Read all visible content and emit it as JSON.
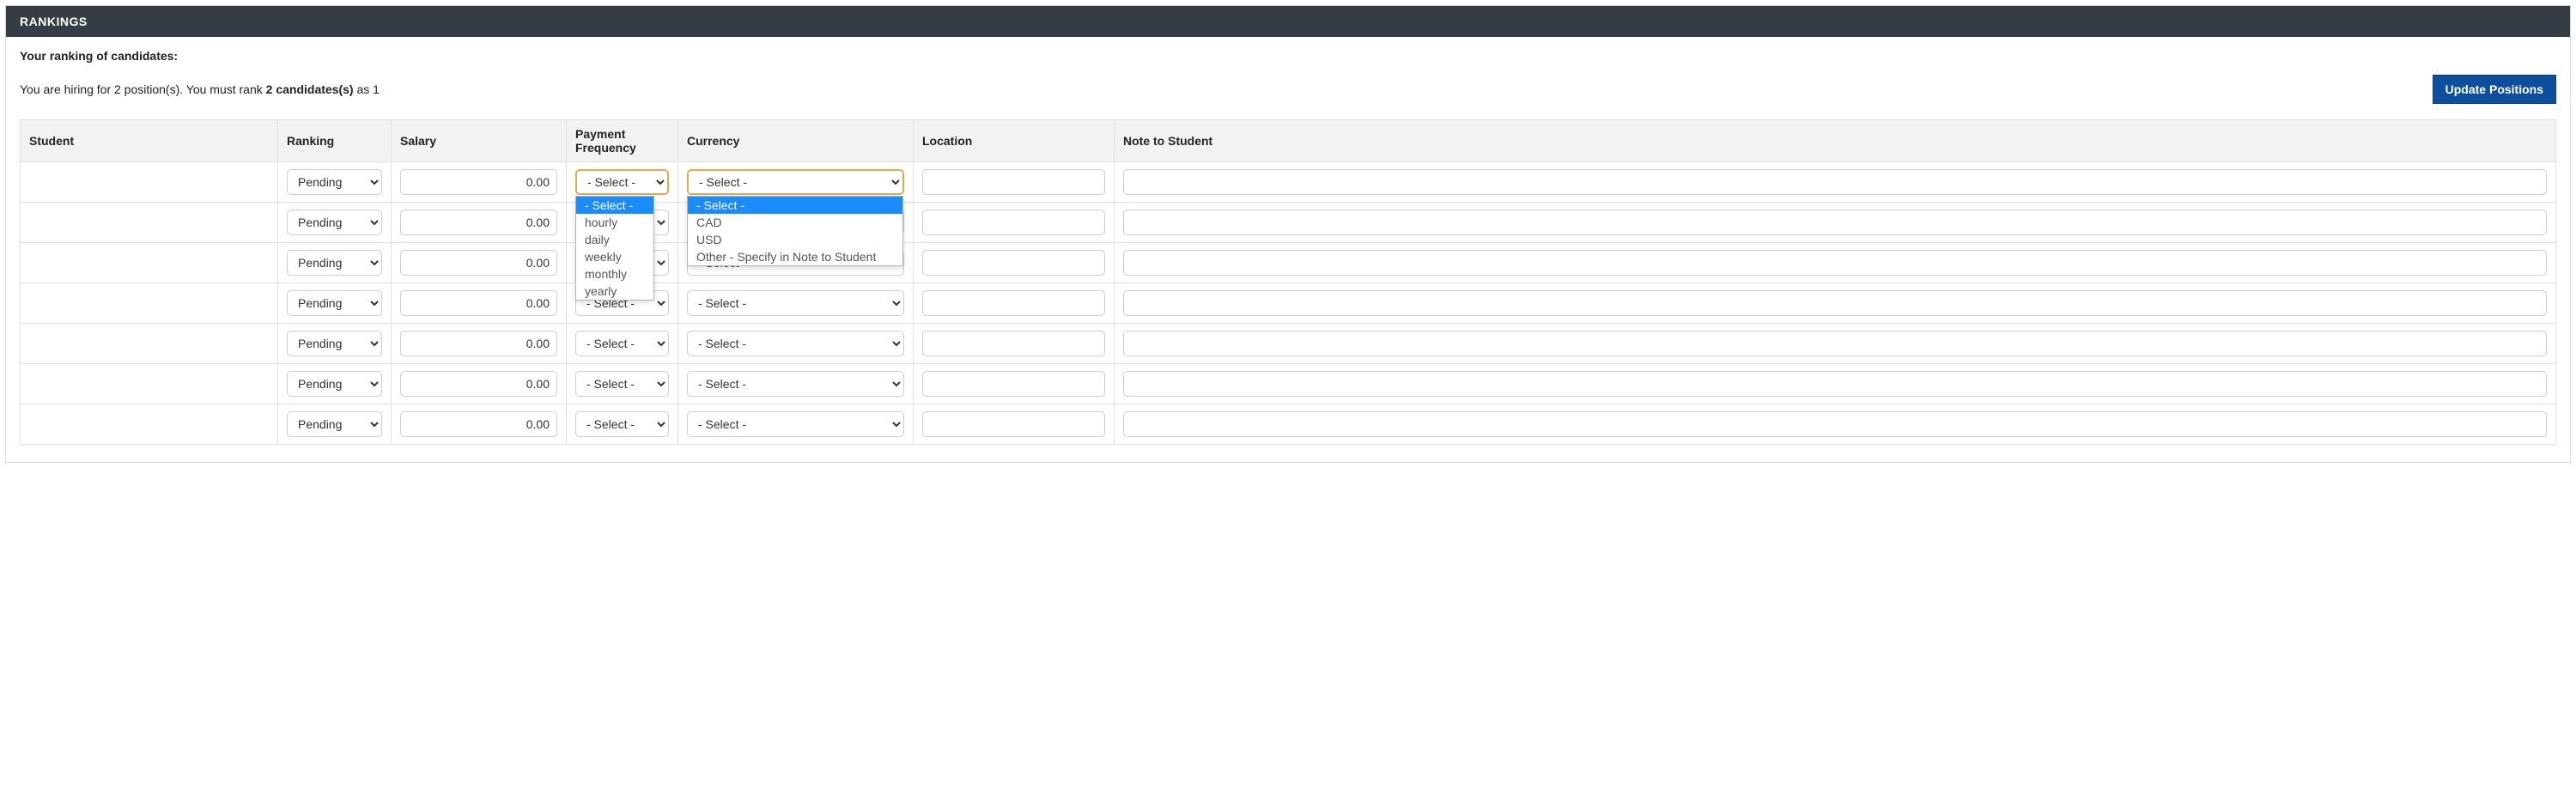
{
  "header": {
    "title": "RANKINGS"
  },
  "subtitle": "Your ranking of candidates:",
  "info": {
    "pre": "You are hiring for 2 position(s). You must rank ",
    "bold": "2 candidates(s)",
    "post": " as 1"
  },
  "buttons": {
    "update_positions": "Update Positions"
  },
  "columns": {
    "student": "Student",
    "ranking": "Ranking",
    "salary": "Salary",
    "freq": "Payment Frequency",
    "currency": "Currency",
    "location": "Location",
    "note": "Note to Student"
  },
  "select_placeholder": "- Select -",
  "ranking_options": [
    "Pending"
  ],
  "freq_options": [
    "- Select -",
    "hourly",
    "daily",
    "weekly",
    "monthly",
    "yearly"
  ],
  "currency_options": [
    "- Select -",
    "CAD",
    "USD",
    "Other - Specify in Note to Student"
  ],
  "rows": [
    {
      "student": "",
      "ranking": "Pending",
      "salary": "0.00",
      "freq": "- Select -",
      "curr": "- Select -",
      "loc": "",
      "note": ""
    },
    {
      "student": "",
      "ranking": "Pending",
      "salary": "0.00",
      "freq": "- Select -",
      "curr": "- Select -",
      "loc": "",
      "note": ""
    },
    {
      "student": "",
      "ranking": "Pending",
      "salary": "0.00",
      "freq": "- Select -",
      "curr": "- Select -",
      "loc": "",
      "note": ""
    },
    {
      "student": "",
      "ranking": "Pending",
      "salary": "0.00",
      "freq": "- Select -",
      "curr": "- Select -",
      "loc": "",
      "note": ""
    },
    {
      "student": "",
      "ranking": "Pending",
      "salary": "0.00",
      "freq": "- Select -",
      "curr": "- Select -",
      "loc": "",
      "note": ""
    },
    {
      "student": "",
      "ranking": "Pending",
      "salary": "0.00",
      "freq": "- Select -",
      "curr": "- Select -",
      "loc": "",
      "note": ""
    },
    {
      "student": "",
      "ranking": "Pending",
      "salary": "0.00",
      "freq": "- Select -",
      "curr": "- Select -",
      "loc": "",
      "note": ""
    }
  ],
  "open_row_index": 0
}
